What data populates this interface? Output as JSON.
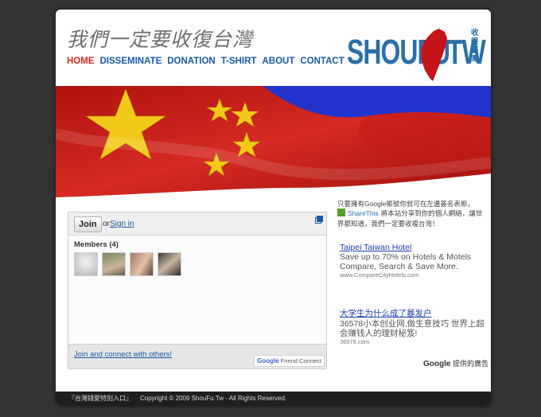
{
  "header": {
    "calligraphy": "我們一定要收復台灣",
    "nav": [
      "HOME",
      "DISSEMINATE",
      "DONATION",
      "T-SHIRT",
      "ABOUT",
      "CONTACT"
    ],
    "logo_left": "SHOUFU",
    "logo_right": "TW",
    "logo_cn": "收復臺灣"
  },
  "widget": {
    "join_label": "Join",
    "or_text": "or",
    "signin_label": "Sign in",
    "members_title": "Members (4)",
    "connect_label": "Join and connect with others!",
    "gfc_google": "Google",
    "gfc_label": "Friend Connect"
  },
  "sidebar": {
    "intro": "只要擁有Google帳號你就可在左邊簽名表態，",
    "share_label": "ShareThis",
    "share_text": "將本站分享到你的個人網絡，讓世界都知道，我們一定要收複台灣！"
  },
  "ads": [
    {
      "title": "Taipei Taiwan Hotel",
      "desc": "Save up to 70% on Hotels & Motels Compare, Search & Save More.",
      "url": "www.CompareCityHotels.com"
    },
    {
      "title": "大学生为什么成了暴发户",
      "desc": "36578小本创业网,做生意技巧 世界上超会赚钱人的理财秘笈!",
      "url": "36578.com"
    }
  ],
  "ads_by": {
    "google": "Google",
    "label": "提供的廣告"
  },
  "footer": {
    "link": "『台灣錢愛特別入口』",
    "copyright": "Copyright © 2009 ShouFu.Tw - All Rights Reserved."
  },
  "colors": {
    "accent": "#1b59a3",
    "active": "#e0261f",
    "logo_blue": "#2b6fa8",
    "logo_red": "#c5141a",
    "flag_red": "#c41a17",
    "flag_blue": "#2233cc",
    "star_yellow": "#f2c919"
  }
}
